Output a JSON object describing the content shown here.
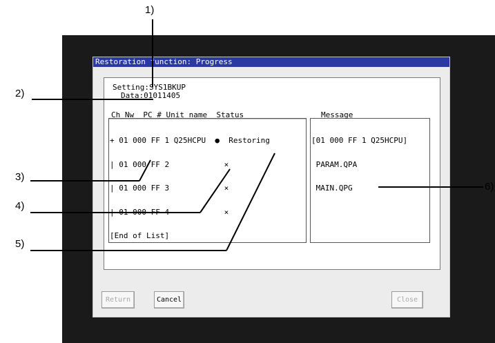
{
  "window": {
    "title": "Restoration function: Progress"
  },
  "setting": {
    "label": "Setting",
    "value": "SYS1BKUP"
  },
  "data_field": {
    "label": "Data",
    "value": "01011405"
  },
  "unit_list": {
    "headers": {
      "ch": "Ch",
      "nw": "Nw",
      "pc": "PC #",
      "unit_name": "Unit name",
      "status": "Status"
    },
    "rows": [
      {
        "tree": "+",
        "ch": "01",
        "nw": "000",
        "pc": "FF",
        "num": "1",
        "unit_name": "Q25HCPU",
        "mark": "●",
        "status": "Restoring"
      },
      {
        "tree": "|",
        "ch": "01",
        "nw": "000",
        "pc": "FF",
        "num": "2",
        "unit_name": "",
        "mark": "×",
        "status": ""
      },
      {
        "tree": "|",
        "ch": "01",
        "nw": "000",
        "pc": "FF",
        "num": "3",
        "unit_name": "",
        "mark": "×",
        "status": ""
      },
      {
        "tree": "|",
        "ch": "01",
        "nw": "000",
        "pc": "FF",
        "num": "4",
        "unit_name": "",
        "mark": "×",
        "status": ""
      }
    ],
    "end_label": "[End of List]"
  },
  "message_panel": {
    "header": "Message",
    "lines": [
      "[01 000 FF 1 Q25HCPU]",
      " PARAM.QPA",
      " MAIN.QPG"
    ]
  },
  "buttons": {
    "return": "Return",
    "cancel": "Cancel",
    "close": "Close"
  },
  "callouts": [
    "1)",
    "2)",
    "3)",
    "4)",
    "5)",
    "6)"
  ],
  "colors": {
    "title_bar": "#2a3aa0",
    "bezel": "#1a1a1a"
  }
}
